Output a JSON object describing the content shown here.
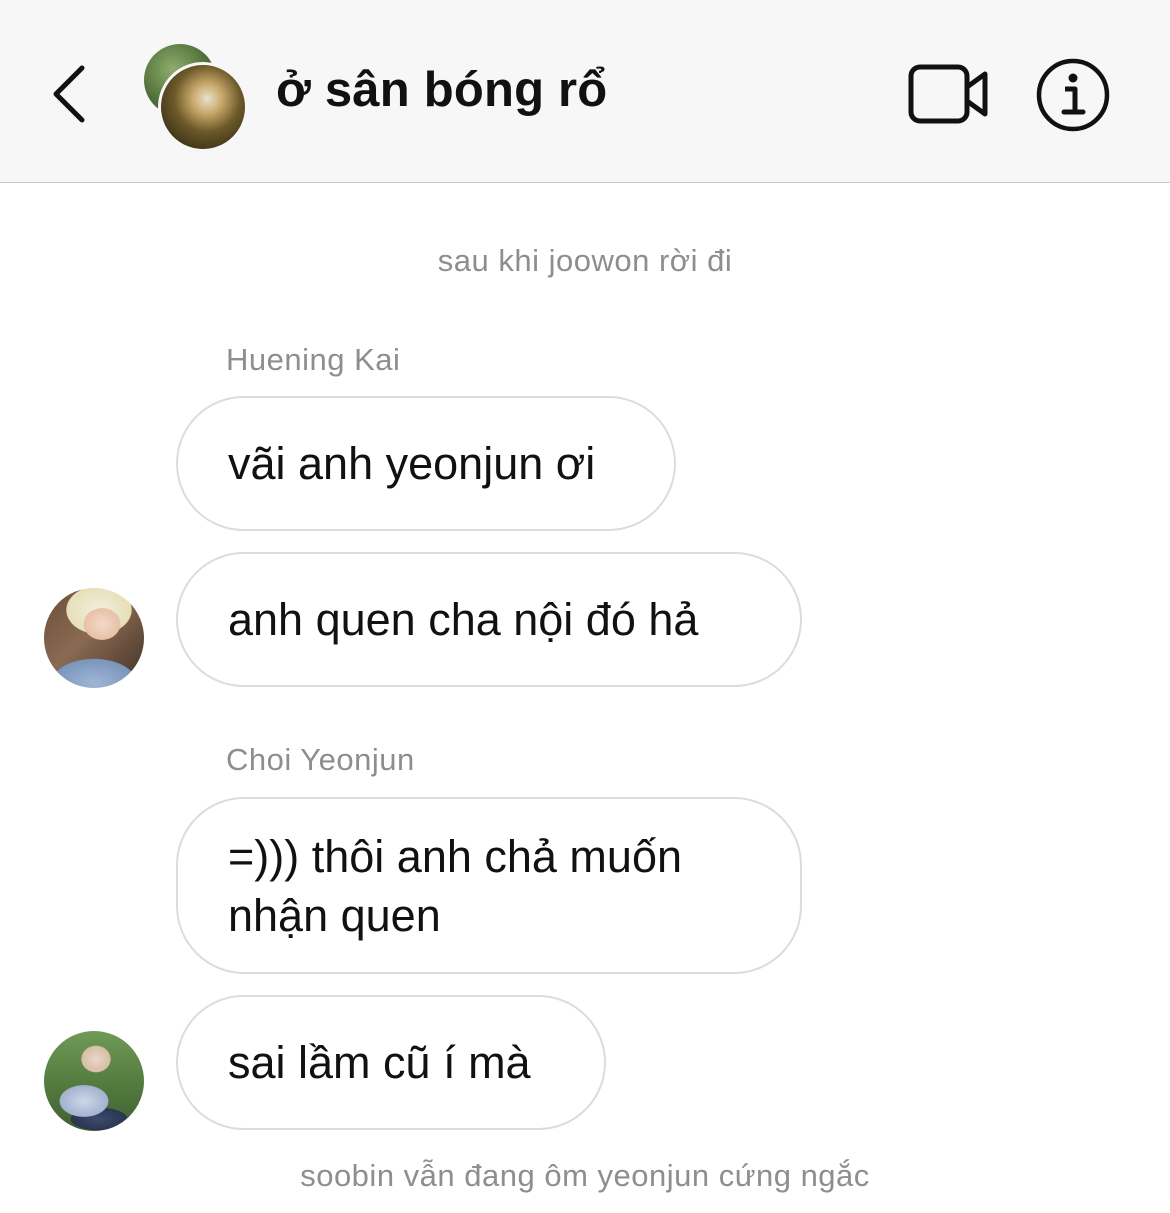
{
  "header": {
    "back_icon": "chevron-left-icon",
    "title": "ở sân bóng rổ",
    "video_icon": "video-camera-icon",
    "info_icon": "info-icon"
  },
  "messages_area": {
    "system_top": "sau khi joowon rời đi",
    "groups": [
      {
        "sender": "Huening Kai",
        "bubbles": [
          "vãi anh yeonjun ơi",
          "anh quen cha nội đó hả"
        ]
      },
      {
        "sender": "Choi Yeonjun",
        "bubbles": [
          "=))) thôi anh chả muốn\nnhận quen",
          "sai lầm cũ í mà"
        ]
      }
    ],
    "system_bottom": "soobin vẫn đang ôm yeonjun cứng ngắc"
  },
  "colors": {
    "header_bg": "#f7f7f7",
    "bubble_border": "#dcdcdc",
    "muted_text": "#8e8e8e",
    "text": "#111111"
  }
}
